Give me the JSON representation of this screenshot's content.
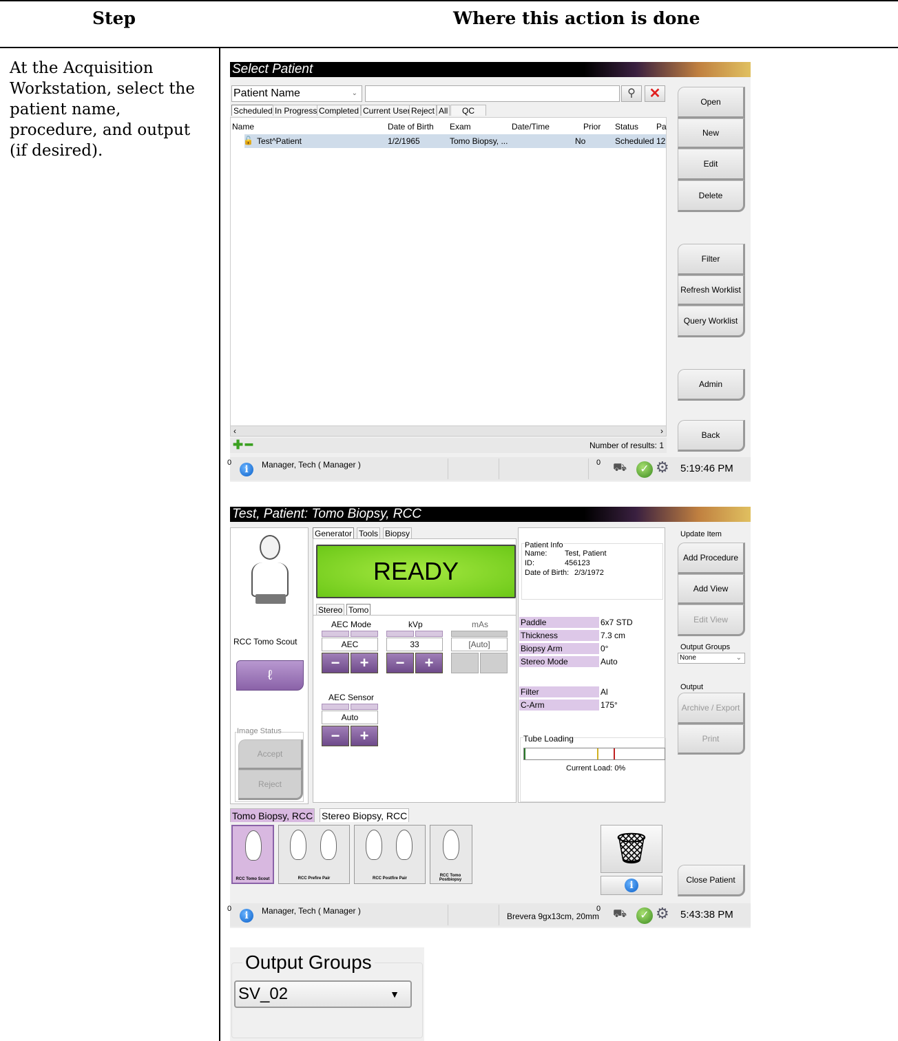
{
  "doc": {
    "col_step": "Step",
    "col_where": "Where this action is done",
    "step_text": "At the Acquisition Workstation, select the patient name, procedure, and output (if desired)."
  },
  "select_patient": {
    "title": "Select Patient",
    "search_field_label": "Patient Name",
    "search_value": "",
    "tabs": [
      "Scheduled",
      "In Progress",
      "Completed",
      "Current User",
      "Reject",
      "All",
      "QC"
    ],
    "columns": [
      "Name",
      "Date of Birth",
      "Exam",
      "Date/Time",
      "Prior",
      "Status",
      "Pa"
    ],
    "row": {
      "name": "Test^Patient",
      "dob": "1/2/1965",
      "exam": "Tomo Biopsy, ...",
      "datetime": "",
      "prior": "No",
      "status": "Scheduled",
      "pa": "12"
    },
    "buttons": [
      "Open",
      "New",
      "Edit",
      "Delete",
      "Filter",
      "Refresh Worklist",
      "Query Worklist",
      "Admin",
      "Back"
    ],
    "results": "Number of results: 1",
    "status": {
      "count": "0",
      "user": "Manager, Tech ( Manager )",
      "badge": "0",
      "time": "5:19:46 PM"
    }
  },
  "procedure": {
    "title": "Test, Patient:  Tomo Biopsy, RCC",
    "tabs": [
      "Generator",
      "Tools",
      "Biopsy"
    ],
    "ready": "READY",
    "patient_info": {
      "heading": "Patient Info",
      "name_label": "Name:",
      "name": "Test, Patient",
      "id_label": "ID:",
      "id": "456123",
      "dob_label": "Date of Birth:",
      "dob": "2/3/1972"
    },
    "view_label": "RCC Tomo Scout",
    "subtabs": [
      "Stereo",
      "Tomo"
    ],
    "aec_mode_label": "AEC Mode",
    "aec_mode_value": "AEC",
    "kvp_label": "kVp",
    "kvp_value": "33",
    "mas_label": "mAs",
    "mas_value": "[Auto]",
    "aec_sensor_label": "AEC Sensor",
    "aec_sensor_value": "Auto",
    "props": [
      {
        "label": "Paddle",
        "value": "6x7 STD"
      },
      {
        "label": "Thickness",
        "value": "7.3 cm"
      },
      {
        "label": "Biopsy Arm",
        "value": "0°"
      },
      {
        "label": "Stereo Mode",
        "value": "Auto"
      },
      {
        "label": "Filter",
        "value": "Al"
      },
      {
        "label": "C-Arm",
        "value": "175°"
      }
    ],
    "tube_loading": "Tube Loading",
    "current_load": "Current Load: 0%",
    "image_status": "Image Status",
    "accept": "Accept",
    "reject": "Reject",
    "update_item": "Update Item",
    "add_procedure": "Add Procedure",
    "add_view": "Add View",
    "edit_view": "Edit View",
    "output_groups_label": "Output Groups",
    "output_groups_value": "None",
    "output_label": "Output",
    "archive_export": "Archive / Export",
    "print": "Print",
    "close_patient": "Close Patient",
    "bottom_tabs": [
      "Tomo Biopsy, RCC",
      "Stereo Biopsy, RCC"
    ],
    "thumbs": [
      "RCC Tomo Scout",
      "RCC Prefire Pair",
      "RCC Postfire Pair",
      "RCC Tomo Postbiopsy"
    ],
    "status": {
      "count": "0",
      "user": "Manager, Tech ( Manager )",
      "paddle": "Brevera 9gx13cm, 20mm",
      "badge": "0",
      "time": "5:43:38 PM"
    }
  },
  "output_groups_zoom": {
    "label": "Output Groups",
    "value": "SV_02"
  }
}
